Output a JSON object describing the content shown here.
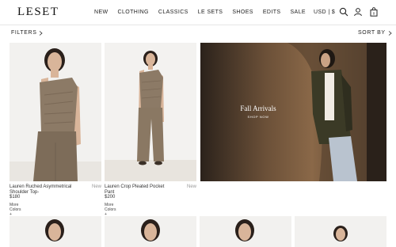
{
  "brand": {
    "logo": "LESET"
  },
  "nav": [
    {
      "label": "NEW"
    },
    {
      "label": "CLOTHING"
    },
    {
      "label": "CLASSICS"
    },
    {
      "label": "LE SETS"
    },
    {
      "label": "SHOES"
    },
    {
      "label": "EDITS"
    },
    {
      "label": "SALE"
    }
  ],
  "header": {
    "currency": "USD | $",
    "icons": [
      "search-icon",
      "account-icon",
      "bag-icon"
    ],
    "bag_count": "0"
  },
  "toolbar": {
    "filters": "FILTERS",
    "sort": "SORT BY"
  },
  "products": [
    {
      "name": "Lauren Ruched Asymmetrical Shoulder Top-",
      "badge": "New",
      "price": "$180",
      "more_colors": "More Colors +"
    },
    {
      "name": "Lauren Crop Pleated Pocket Pant",
      "badge": "New",
      "price": "$200",
      "more_colors": "More Colors +"
    }
  ],
  "hero": {
    "title": "Fall Arrivals",
    "cta": "SHOP NOW"
  },
  "colors": {
    "garment": "#8c7a66",
    "skin": "#d9b59a",
    "hair": "#2a201b",
    "bg_light": "#f2f1ef",
    "hero_bg": "#3a2f25"
  }
}
